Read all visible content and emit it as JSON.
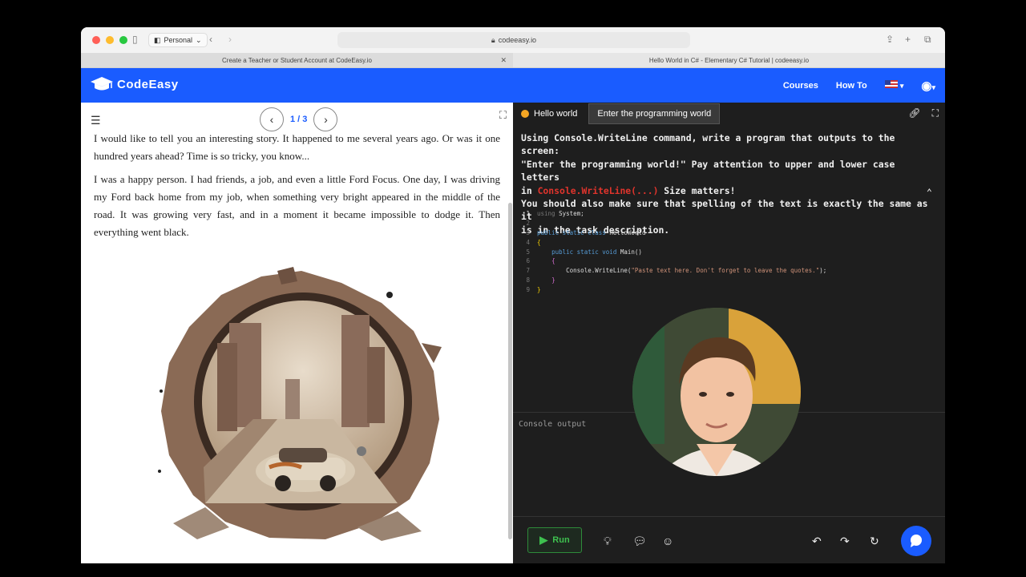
{
  "browser": {
    "profile": "Personal",
    "url": "codeeasy.io",
    "tabs": [
      {
        "title": "Create a Teacher or Student Account at CodeEasy.io",
        "active": false
      },
      {
        "title": "Hello World in C# - Elementary C# Tutorial | codeeasy.io",
        "active": true
      }
    ]
  },
  "site": {
    "logo": "CodeEasy",
    "nav": {
      "courses": "Courses",
      "howto": "How To"
    }
  },
  "story": {
    "page": "1 / 3",
    "paragraph1": "I would like to tell you an interesting story. It happened to me several years ago. Or was it one hundred years ahead? Time is so tricky, you know...",
    "paragraph2": "I was a happy person. I had friends, a job, and even a little Ford Focus. One day, I was driving my Ford back home from my job, when something very bright appeared in the middle of the road. It was growing very fast, and in a moment it became impossible to dodge it. Then everything went black."
  },
  "task": {
    "tab1": "Hello world",
    "tab2": "Enter the programming world",
    "line1": "Using Console.WriteLine command, write a program that outputs to the screen:",
    "line2": "\"Enter the programming world!\" Pay attention to upper and lower case letters",
    "line3_pre": "in ",
    "line3_code": "Console.WriteLine(...)",
    "line3_post": " Size matters!",
    "line4": "You should also make sure that spelling of the text is exactly the same as it",
    "line5": "is in the task description."
  },
  "editor": {
    "line_numbers": [
      "1",
      "2",
      "3",
      "4",
      "5",
      "6",
      "7",
      "8",
      "9"
    ],
    "using": "using",
    "system": "System;",
    "public1": "public static class",
    "classname": "HelloWorld",
    "open1": "{",
    "public2": "public static void",
    "main": "Main()",
    "open2": "{",
    "console": "Console.WriteLine(",
    "string": "\"Paste text here. Don't forget to leave the quotes.\"",
    "close_call": ");",
    "close2": "}",
    "close1": "}"
  },
  "console": {
    "placeholder": "Console output"
  },
  "controls": {
    "run": "Run"
  },
  "colors": {
    "brand": "#1a5cff",
    "run_green": "#3ec14f",
    "editor_bg": "#1e1e1e"
  }
}
